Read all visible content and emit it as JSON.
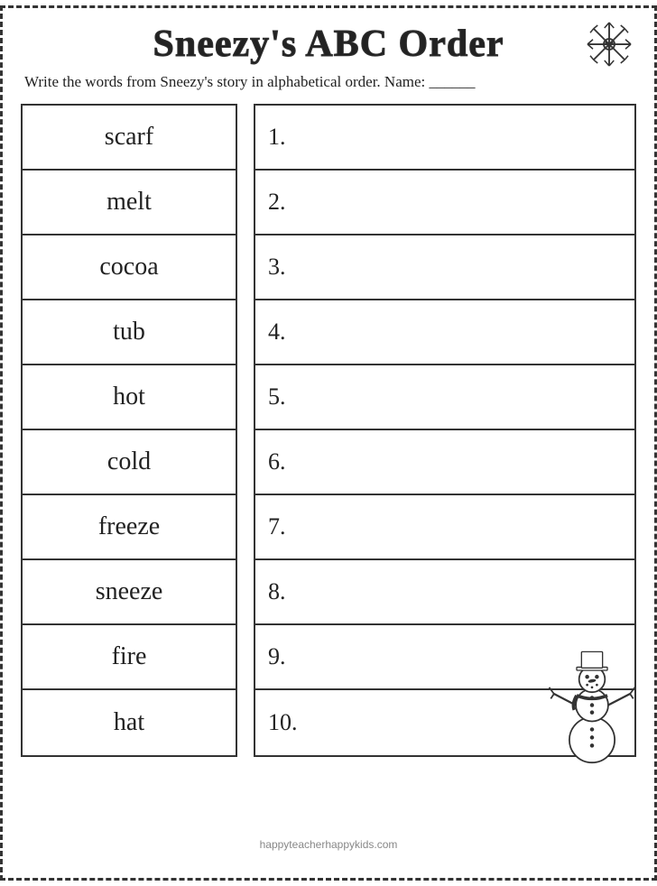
{
  "title": "Sneezy's ABC Order",
  "instructions": "Write the words from Sneezy's story in alphabetical order. Name: ______",
  "words": [
    "scarf",
    "melt",
    "cocoa",
    "tub",
    "hot",
    "cold",
    "freeze",
    "sneeze",
    "fire",
    "hat"
  ],
  "answer_numbers": [
    "1.",
    "2.",
    "3.",
    "4.",
    "5.",
    "6.",
    "7.",
    "8.",
    "9.",
    "10."
  ],
  "footer": "happyteacherhappykids.com"
}
